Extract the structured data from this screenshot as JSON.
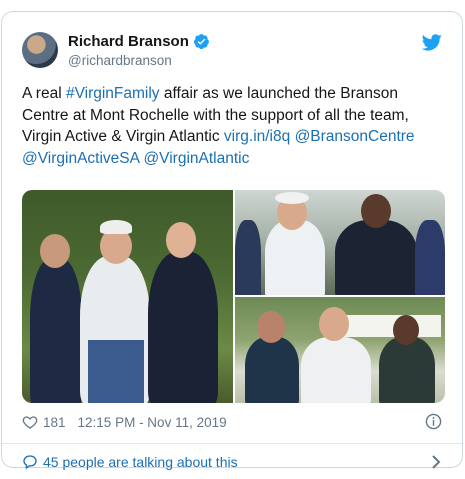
{
  "tweet": {
    "author_name": "Richard Branson",
    "author_handle": "@richardbranson",
    "text_parts": [
      {
        "text": "A real ",
        "link": false
      },
      {
        "text": "#VirginFamily",
        "link": true
      },
      {
        "text": " affair as we launched the Branson Centre at Mont Rochelle with the support of all the team, Virgin Active & Virgin Atlantic ",
        "link": false
      },
      {
        "text": "virg.in/i8q",
        "link": true
      },
      {
        "text": " ",
        "link": false
      },
      {
        "text": "@BransonCentre",
        "link": true
      },
      {
        "text": " ",
        "link": false
      },
      {
        "text": "@VirginActiveSA",
        "link": true
      },
      {
        "text": " ",
        "link": false
      },
      {
        "text": "@VirginAtlantic",
        "link": true
      }
    ],
    "like_count": "181",
    "timestamp": "12:15 PM - Nov 11, 2019",
    "conversation_text": "45 people are talking about this"
  },
  "icons": {
    "verified": "verified-badge-icon",
    "brand": "twitter-bird-icon",
    "like": "heart-icon",
    "info": "info-icon",
    "conversation": "speech-bubble-icon",
    "chevron": "chevron-right-icon"
  },
  "colors": {
    "link": "#1b6fb4",
    "brand_blue": "#1da1f2",
    "muted": "#657786",
    "border": "#cfd9de"
  }
}
